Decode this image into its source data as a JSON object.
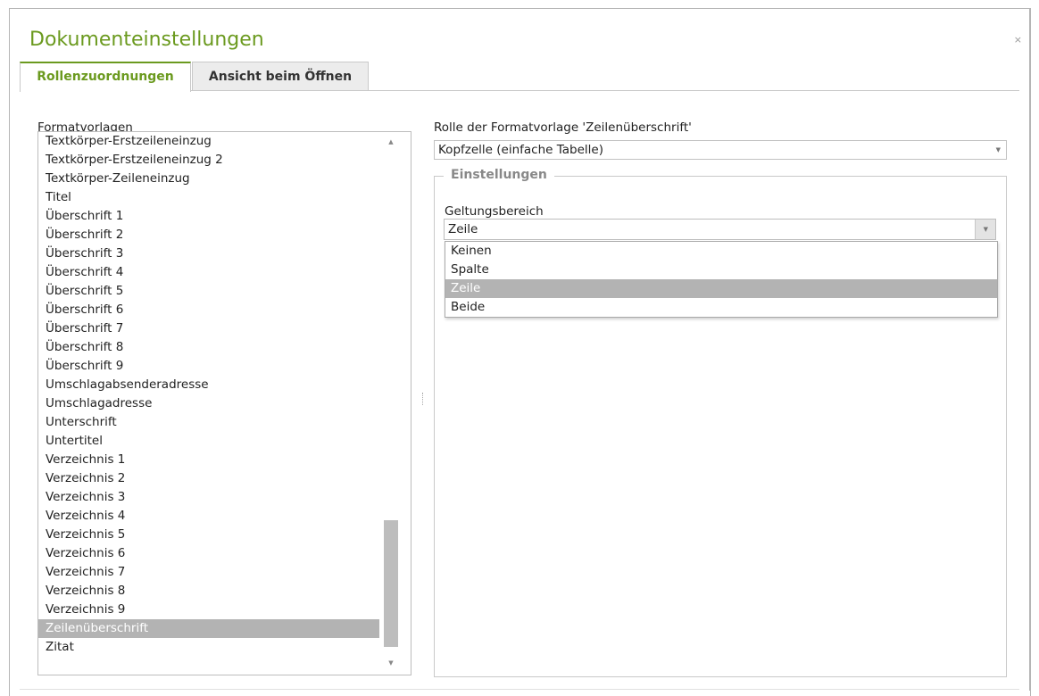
{
  "dialog": {
    "title": "Dokumenteinstellungen",
    "close_glyph": "×",
    "close_icon": "close-icon"
  },
  "tabs": [
    {
      "label": "Rollenzuordnungen",
      "active": true
    },
    {
      "label": "Ansicht beim Öffnen",
      "active": false
    }
  ],
  "styles_list": {
    "label": "Formatvorlagen",
    "items": [
      "Textkörper-Erstzeileneinzug",
      "Textkörper-Erstzeileneinzug 2",
      "Textkörper-Zeileneinzug",
      "Titel",
      "Überschrift 1",
      "Überschrift 2",
      "Überschrift 3",
      "Überschrift 4",
      "Überschrift 5",
      "Überschrift 6",
      "Überschrift 7",
      "Überschrift 8",
      "Überschrift 9",
      "Umschlagabsenderadresse",
      "Umschlagadresse",
      "Unterschrift",
      "Untertitel",
      "Verzeichnis 1",
      "Verzeichnis 2",
      "Verzeichnis 3",
      "Verzeichnis 4",
      "Verzeichnis 5",
      "Verzeichnis 6",
      "Verzeichnis 7",
      "Verzeichnis 8",
      "Verzeichnis 9",
      "Zeilenüberschrift",
      "Zitat"
    ],
    "selected": "Zeilenüberschrift",
    "scroll_up_glyph": "▲",
    "scroll_down_glyph": "▼"
  },
  "role": {
    "label": "Rolle der Formatvorlage 'Zeilenüberschrift'",
    "value": "Kopfzelle (einfache Tabelle)",
    "arrow_glyph": "▼"
  },
  "settings": {
    "title": "Einstellungen",
    "scope_label": "Geltungsbereich",
    "scope_value": "Zeile",
    "arrow_glyph": "▼",
    "options": [
      "Keinen",
      "Spalte",
      "Zeile",
      "Beide"
    ],
    "selected_option": "Zeile"
  },
  "colors": {
    "accent": "#6b9a1f",
    "selection": "#b3b3b3",
    "border": "#c9c9c9"
  }
}
